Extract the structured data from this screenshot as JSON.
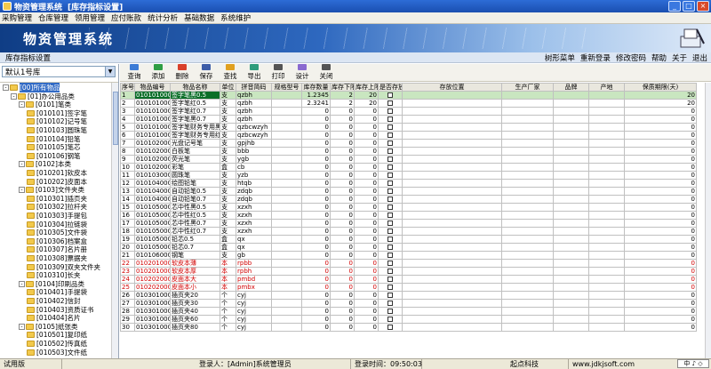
{
  "window": {
    "title": "物资管理系统",
    "subtitle": "[库存指标设置]",
    "min": "_",
    "max": "□",
    "close": "×"
  },
  "menu": [
    "采购管理",
    "仓库管理",
    "领用管理",
    "应付账款",
    "统计分析",
    "基础数据",
    "系统维护"
  ],
  "banner": {
    "app_name": "物资管理系统"
  },
  "strip": {
    "label": "库存指标设置",
    "links": [
      "树形菜单",
      "重新登录",
      "修改密码",
      "帮助",
      "关于",
      "退出"
    ]
  },
  "warehouse": {
    "selected": "默认1号库"
  },
  "tree": [
    {
      "l": 0,
      "t": "[00]所有物品",
      "exp": "-",
      "sel": true
    },
    {
      "l": 1,
      "t": "[01]办公用品类",
      "exp": "-"
    },
    {
      "l": 2,
      "t": "[0101]笔类",
      "exp": "-"
    },
    {
      "l": 3,
      "t": "[010101]签字笔"
    },
    {
      "l": 3,
      "t": "[010102]记号笔"
    },
    {
      "l": 3,
      "t": "[010103]圆珠笔"
    },
    {
      "l": 3,
      "t": "[010104]铅笔"
    },
    {
      "l": 3,
      "t": "[010105]笔芯"
    },
    {
      "l": 3,
      "t": "[010106]钢笔"
    },
    {
      "l": 2,
      "t": "[0102]本类",
      "exp": "-"
    },
    {
      "l": 3,
      "t": "[010201]软皮本"
    },
    {
      "l": 3,
      "t": "[010202]皮面本"
    },
    {
      "l": 2,
      "t": "[0103]文件夹类",
      "exp": "-"
    },
    {
      "l": 3,
      "t": "[010301]插页夹"
    },
    {
      "l": 3,
      "t": "[010302]拉杆夹"
    },
    {
      "l": 3,
      "t": "[010303]手提包"
    },
    {
      "l": 3,
      "t": "[010304]拉链袋"
    },
    {
      "l": 3,
      "t": "[010305]文件袋"
    },
    {
      "l": 3,
      "t": "[010306]档案盒"
    },
    {
      "l": 3,
      "t": "[010307]名片册"
    },
    {
      "l": 3,
      "t": "[010308]票据夹"
    },
    {
      "l": 3,
      "t": "[010309]双夹文件夹"
    },
    {
      "l": 3,
      "t": "[010310]长夹"
    },
    {
      "l": 2,
      "t": "[0104]印刷品类",
      "exp": "-"
    },
    {
      "l": 3,
      "t": "[010401]手提袋"
    },
    {
      "l": 3,
      "t": "[010402]信封"
    },
    {
      "l": 3,
      "t": "[010403]资质证书"
    },
    {
      "l": 3,
      "t": "[010404]名片"
    },
    {
      "l": 2,
      "t": "[0105]纸张类",
      "exp": "-"
    },
    {
      "l": 3,
      "t": "[010501]复印纸"
    },
    {
      "l": 3,
      "t": "[010502]传真纸"
    },
    {
      "l": 3,
      "t": "[010503]文件纸"
    }
  ],
  "toolbar": [
    {
      "label": "查询",
      "color": "#3b7bd6",
      "icon": "search-icon"
    },
    {
      "label": "添加",
      "color": "#2f9e44",
      "icon": "add-icon"
    },
    {
      "label": "删除",
      "color": "#d9402b",
      "icon": "delete-icon"
    },
    {
      "label": "保存",
      "color": "#3d5da8",
      "icon": "save-icon"
    },
    {
      "label": "查找",
      "color": "#e0a020",
      "icon": "find-icon"
    },
    {
      "label": "导出",
      "color": "#2e9c7c",
      "icon": "export-icon"
    },
    {
      "label": "打印",
      "color": "#555",
      "icon": "print-icon"
    },
    {
      "label": "设计",
      "color": "#8a6ad0",
      "icon": "design-icon"
    },
    {
      "label": "关闭",
      "color": "#555",
      "icon": "close-icon"
    }
  ],
  "grid": {
    "headers": [
      "序号",
      "物品编号",
      "物品名称",
      "单位",
      "拼音简码",
      "规格型号",
      "库存数量",
      "库存下限",
      "库存上限",
      "是否存放",
      "存放位置",
      "生产厂家",
      "品牌",
      "产地",
      "保质期限(天)"
    ],
    "rows": [
      [
        "1",
        "0101010001",
        "签字笔黑0.5",
        "支",
        "qzbh",
        "",
        "1.2345",
        "2",
        "20",
        "",
        ""
      ],
      [
        "2",
        "0101010002",
        "签字笔红0.5",
        "支",
        "qzbh",
        "",
        "2.3241",
        "2",
        "20",
        "",
        ""
      ],
      [
        "3",
        "0101010003",
        "签字笔红0.7",
        "支",
        "qzbh",
        "",
        "0",
        "0",
        "0",
        "",
        ""
      ],
      [
        "4",
        "0101010004",
        "签字笔黑0.7",
        "支",
        "qzbh",
        "",
        "0",
        "0",
        "0",
        "",
        ""
      ],
      [
        "5",
        "0101010005",
        "签字笔财务专用黑",
        "支",
        "qzbcwzyh",
        "",
        "0",
        "0",
        "0",
        "",
        ""
      ],
      [
        "6",
        "0101010006",
        "签字笔财务专用红",
        "支",
        "qzbcwzyh",
        "",
        "0",
        "0",
        "0",
        "",
        ""
      ],
      [
        "7",
        "0101020001",
        "光盘记号笔",
        "支",
        "gpjhb",
        "",
        "0",
        "0",
        "0",
        "",
        ""
      ],
      [
        "8",
        "0101020002",
        "白板笔",
        "支",
        "bbb",
        "",
        "0",
        "0",
        "0",
        "",
        ""
      ],
      [
        "9",
        "0101020003",
        "荧光笔",
        "支",
        "ygb",
        "",
        "0",
        "0",
        "0",
        "",
        ""
      ],
      [
        "10",
        "0101020004",
        "彩笔",
        "盒",
        "cb",
        "",
        "0",
        "0",
        "0",
        "",
        ""
      ],
      [
        "11",
        "0101030001",
        "圆珠笔",
        "支",
        "yzb",
        "",
        "0",
        "0",
        "0",
        "",
        ""
      ],
      [
        "12",
        "0101040001",
        "绘图铅笔",
        "支",
        "htqb",
        "",
        "0",
        "0",
        "0",
        "",
        ""
      ],
      [
        "13",
        "0101040002",
        "自动铅笔0.5",
        "支",
        "zdqb",
        "",
        "0",
        "0",
        "0",
        "",
        ""
      ],
      [
        "14",
        "0101040003",
        "自动铅笔0.7",
        "支",
        "zdqb",
        "",
        "0",
        "0",
        "0",
        "",
        ""
      ],
      [
        "15",
        "0101050001",
        "芯中性黑0.5",
        "支",
        "xzxh",
        "",
        "0",
        "0",
        "0",
        "",
        ""
      ],
      [
        "16",
        "0101050002",
        "芯中性红0.5",
        "支",
        "xzxh",
        "",
        "0",
        "0",
        "0",
        "",
        ""
      ],
      [
        "17",
        "0101050003",
        "芯中性黑0.7",
        "支",
        "xzxh",
        "",
        "0",
        "0",
        "0",
        "",
        ""
      ],
      [
        "18",
        "0101050004",
        "芯中性红0.7",
        "支",
        "xzxh",
        "",
        "0",
        "0",
        "0",
        "",
        ""
      ],
      [
        "19",
        "0101050005",
        "铅芯0.5",
        "盒",
        "qx",
        "",
        "0",
        "0",
        "0",
        "",
        ""
      ],
      [
        "20",
        "0101050006",
        "铅芯0.7",
        "盒",
        "qx",
        "",
        "0",
        "0",
        "0",
        "",
        ""
      ],
      [
        "21",
        "0101060001",
        "钢笔",
        "支",
        "gb",
        "",
        "0",
        "0",
        "0",
        "",
        ""
      ],
      [
        "22",
        "0102010001",
        "软皮本薄",
        "本",
        "rpbb",
        "",
        "0",
        "0",
        "0",
        "",
        ""
      ],
      [
        "23",
        "0102010002",
        "软皮本厚",
        "本",
        "rpbh",
        "",
        "0",
        "0",
        "0",
        "",
        ""
      ],
      [
        "24",
        "0102020001",
        "皮面本大",
        "本",
        "pmbd",
        "",
        "0",
        "0",
        "0",
        "",
        ""
      ],
      [
        "25",
        "0102020002",
        "皮面本小",
        "本",
        "pmbx",
        "",
        "0",
        "0",
        "0",
        "",
        ""
      ],
      [
        "26",
        "0103010001",
        "插页夹20",
        "个",
        "cyj",
        "",
        "0",
        "0",
        "0",
        "",
        ""
      ],
      [
        "27",
        "0103010002",
        "插页夹30",
        "个",
        "cyj",
        "",
        "0",
        "0",
        "0",
        "",
        ""
      ],
      [
        "28",
        "0103010003",
        "插页夹40",
        "个",
        "cyj",
        "",
        "0",
        "0",
        "0",
        "",
        ""
      ],
      [
        "29",
        "0103010004",
        "插页夹60",
        "个",
        "cyj",
        "",
        "0",
        "0",
        "0",
        "",
        ""
      ],
      [
        "30",
        "0103010005",
        "插页夹80",
        "个",
        "cyj",
        "",
        "0",
        "0",
        "0",
        "",
        ""
      ]
    ],
    "red_rows": [
      21,
      22,
      23,
      24
    ],
    "selected_row": 0
  },
  "status": {
    "mode": "试用版",
    "user": "登录人：[Admin]系统管理员",
    "time": "登录时间：09:50:03",
    "company": "起点科技",
    "site": "www.jdkjsoft.com",
    "ime": "中 ♪ ◇"
  }
}
